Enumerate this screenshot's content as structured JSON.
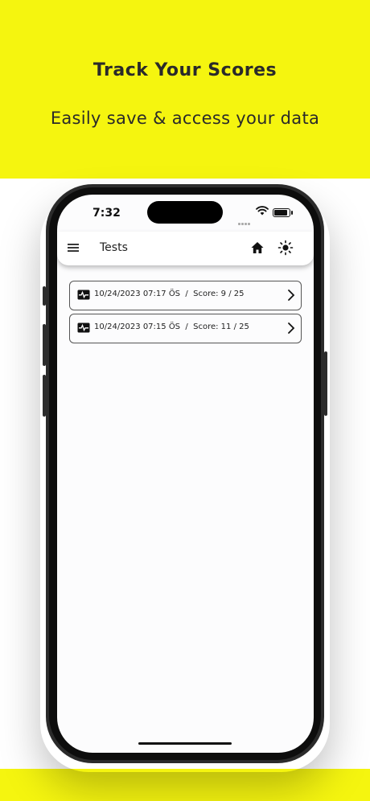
{
  "banner": {
    "title": "Track Your Scores",
    "subtitle": "Easily save & access your data"
  },
  "status_bar": {
    "time": "7:32"
  },
  "app_bar": {
    "title": "Tests",
    "icons": [
      "menu-icon",
      "home-icon",
      "brightness-icon"
    ]
  },
  "tests": [
    {
      "date": "10/24/2023 07:17 ÖS",
      "separator": "/",
      "score": "Score: 9 / 25"
    },
    {
      "date": "10/24/2023 07:15 ÖS",
      "separator": "/",
      "score": "Score: 11 / 25"
    }
  ],
  "colors": {
    "banner": "#f5f50f",
    "text": "#2a2a2a"
  }
}
